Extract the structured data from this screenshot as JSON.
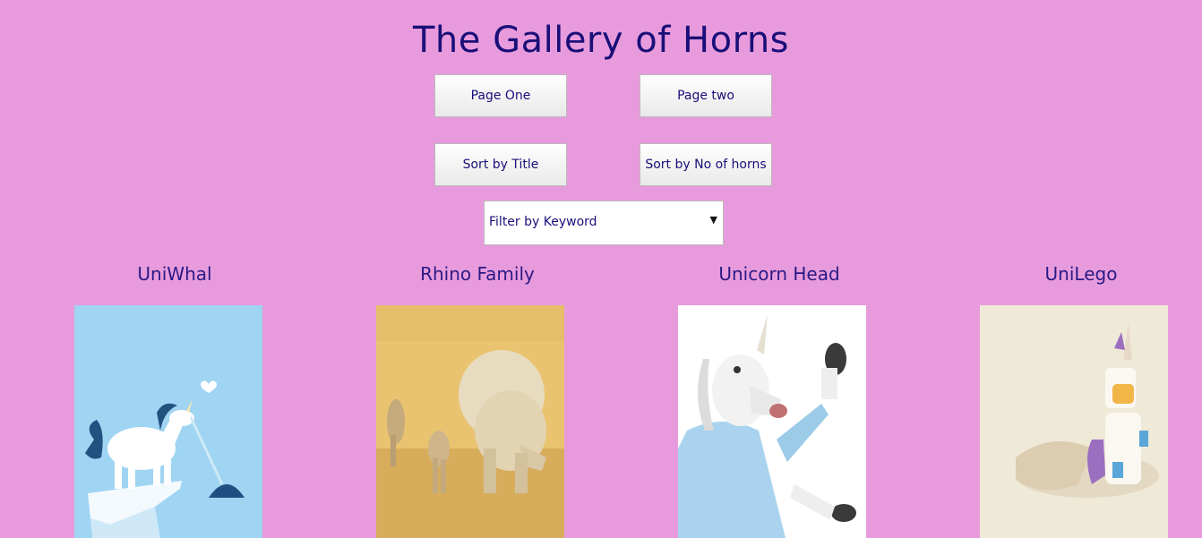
{
  "header": {
    "title": "The Gallery of Horns"
  },
  "buttons": {
    "page_one": "Page One",
    "page_two": "Page two",
    "sort_title": "Sort by Title",
    "sort_horns": "Sort by No of horns"
  },
  "filter": {
    "selected": "Filter by Keyword"
  },
  "gallery": [
    {
      "title": "UniWhal",
      "image": "unicorn-narwhal-illustration"
    },
    {
      "title": "Rhino Family",
      "image": "rhino-family-photo"
    },
    {
      "title": "Unicorn Head",
      "image": "unicorn-mask-person-photo"
    },
    {
      "title": "UniLego",
      "image": "lego-unicorn-figure-photo"
    }
  ],
  "colors": {
    "background": "#e89bdc",
    "text": "#1a0f78"
  }
}
